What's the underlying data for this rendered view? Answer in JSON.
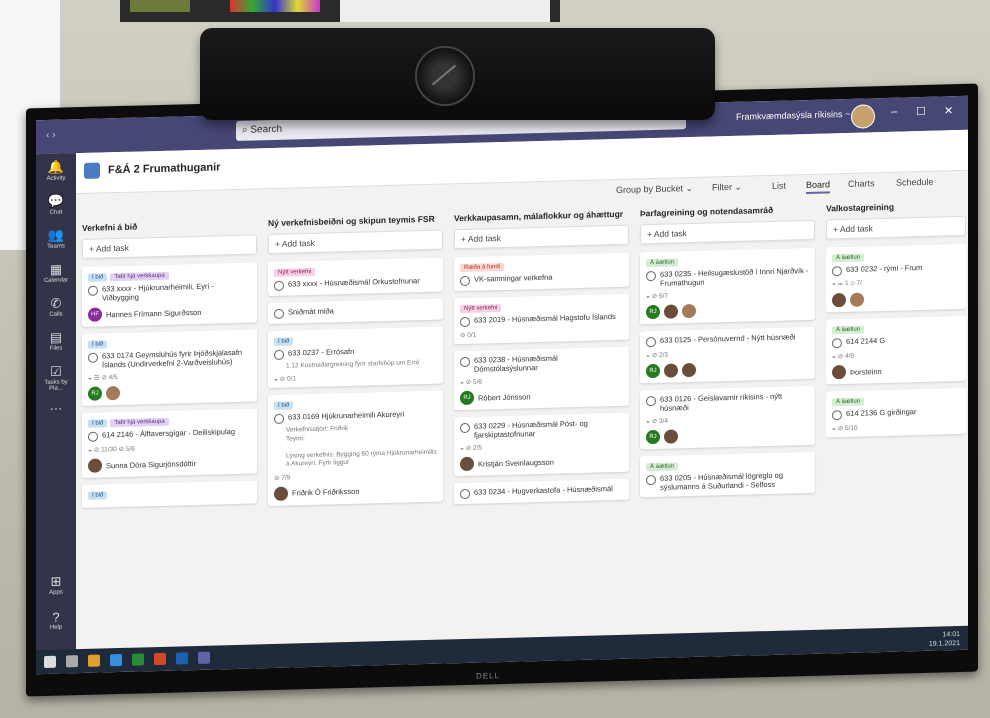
{
  "topbar": {
    "search_placeholder": "Search",
    "org_name": "Framkvæmdasýsla ríkisins ~",
    "minimize": "–",
    "maximize": "☐",
    "close": "✕"
  },
  "rail": [
    {
      "label": "Activity"
    },
    {
      "label": "Chat"
    },
    {
      "label": "Teams"
    },
    {
      "label": "Calendar"
    },
    {
      "label": "Calls"
    },
    {
      "label": "Files"
    },
    {
      "label": "Tasks by Pla..."
    },
    {
      "label": "…"
    },
    {
      "label": "Apps"
    },
    {
      "label": "Help"
    }
  ],
  "planner": {
    "title": "F&Á 2 Frumathuganir",
    "group_by": "Group by Bucket ⌄",
    "filter": "Filter ⌄",
    "list": "List",
    "board": "Board",
    "charts": "Charts",
    "schedule": "Schedule",
    "add_task": "+ Add task"
  },
  "columns": [
    {
      "title": "Verkefni á bið",
      "cards": [
        {
          "labels": [
            "Í bið",
            "Tafir hjá verkkaupa"
          ],
          "title": "633 xxxx - Hjúkrunarheimili, Eyri - Viðbygging",
          "assignee": "Hannes Frímann Sigurðsson",
          "initials": "HF"
        },
        {
          "labels": [
            "Í bið"
          ],
          "title": "633 0174 Geymsluhús fyrir Þjóðskjalasafn Íslands (Undirverkefni 2-Varðveisluhús)",
          "meta": "◒  ☰  ⊘ 4/5"
        },
        {
          "labels": [
            "Í bið",
            "Tafir hjá verkkaupa"
          ],
          "title": "614 2146 - Álftaversgígar - Deiliskipulag",
          "meta": "◒  ⊘ 11/30  ⊘ 5/6",
          "assignee": "Sunna Dóra Sigurjónsdóttir"
        },
        {
          "labels": [
            "Í bið"
          ],
          "title": ""
        }
      ]
    },
    {
      "title": "Ný verkefnisbeiðni og skipun teymis FSR",
      "cards": [
        {
          "labels": [
            "Nýtt verkefni"
          ],
          "title": "633 xxxx - Húsnæðismál Orkustofnunar"
        },
        {
          "labels": [],
          "title": "Sniðmát miða"
        },
        {
          "labels": [
            "Í bið"
          ],
          "title": "633 0237 - Errósafn",
          "sub": "1.12 Kostnaðargreining fyrir starfshóp um Erró",
          "meta": "◒  ⊘ 0/1"
        },
        {
          "labels": [
            "Í bið"
          ],
          "title": "633 0169 Hjúkrunarheimili Akureyri",
          "note": "Verkefnisstjóri: Friðrik\nTeymi:\n\nLýsing verkefnis: Bygging 60 rýma Hjúkrunarheimilis á Akureyri. Fyrir liggur",
          "meta": "⊘ 7/9",
          "assignee": "Friðrik Ó Friðriksson"
        }
      ]
    },
    {
      "title": "Verkkaupasamn, málaflokkur og áhættugr",
      "cards": [
        {
          "labels": [
            "Ræða á fundi"
          ],
          "title": "VK-samningar verkefna"
        },
        {
          "labels": [
            "Nýtt verkefni"
          ],
          "title": "633 2019 - Húsnæðismál Hagstofu Íslands",
          "meta": "⊘ 0/1"
        },
        {
          "labels": [],
          "title": "633 0238 - Húsnæðismál Dómstólasýslunnar",
          "meta": "◒  ⊘ 5/6",
          "assignee": "Róbert Jónsson",
          "initials": "RJ"
        },
        {
          "labels": [],
          "title": "633 0229 - Húsnæðismál Póst- og fjarskiptastofnunar",
          "meta": "◒  ⊘ 2/5",
          "assignee": "Kristján Sveinlaugsson"
        },
        {
          "labels": [],
          "title": "633 0234 - Hugverkastofa - Húsnæðismál"
        }
      ]
    },
    {
      "title": "Þarfagreining og notendasamráð",
      "cards": [
        {
          "labels": [
            "Á áætlun"
          ],
          "title": "633 0235 - Heilsugæslustöð í Innri Njarðvík - Frumathugun",
          "meta": "◒  ⊘ 6/7",
          "initials": "RJ"
        },
        {
          "labels": [],
          "title": "633 0125 - Persónuvernd - Nýtt húsnæði",
          "meta": "◒  ⊘ 2/3",
          "initials": "RJ"
        },
        {
          "labels": [],
          "title": "633 0126 - Geislavarnir ríkisins - nýtt húsnæði",
          "meta": "◒  ⊘ 3/4",
          "initials": "RJ"
        },
        {
          "labels": [
            "Á áætlun"
          ],
          "title": "633 0205 - Húsnæðismál lögreglu og sýslumanns á Suðurlandi - Selfoss"
        }
      ]
    },
    {
      "title": "Valkostagreining",
      "cards": [
        {
          "labels": [
            "Á áætlun"
          ],
          "title": "633 0232 - rými - Frum",
          "meta": "◒  𝓂 1  ⊘ 7/"
        },
        {
          "labels": [
            "Á áætlun"
          ],
          "title": "614 2144 G",
          "meta": "◒  ⊘ 4/9",
          "assignee": "Þorsteinn"
        },
        {
          "labels": [
            "Á áætlun"
          ],
          "title": "614 2136 G girðingar",
          "meta": "◒  ⊘ 5/10"
        }
      ]
    }
  ],
  "monitor_brand": "DELL",
  "clock": {
    "time": "14:01",
    "date": "19.1.2021"
  }
}
